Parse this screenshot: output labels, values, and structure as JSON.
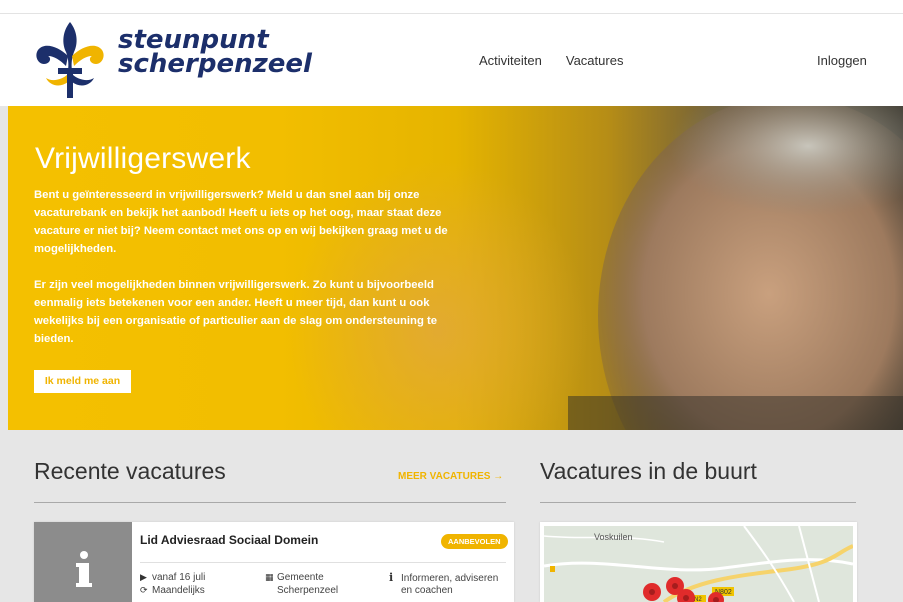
{
  "header": {
    "logo_line1": "steunpunt",
    "logo_line2": "scherpenzeel",
    "nav": [
      "Activiteiten",
      "Vacatures"
    ],
    "login": "Inloggen"
  },
  "hero": {
    "title": "Vrijwilligerswerk",
    "p1": "Bent u geïnteresseerd in vrijwilligerswerk? Meld u dan snel aan bij onze vacaturebank en bekijk het aanbod! Heeft u iets op het oog, maar staat deze vacature er niet bij? Neem contact met ons op en wij bekijken graag met u de mogelijkheden.",
    "p2": "Er zijn veel mogelijkheden binnen vrijwilligerswerk. Zo kunt u bijvoorbeeld eenmalig iets betekenen voor een ander. Heeft u meer tijd, dan kunt u ook wekelijks bij een organisatie of particulier aan de slag om ondersteuning te bieden.",
    "button": "Ik meld me aan"
  },
  "recent": {
    "heading": "Recente vacatures",
    "more": "MEER VACATURES →",
    "card": {
      "title": "Lid Adviesraad Sociaal Domein",
      "badge": "AANBEVOLEN",
      "date": "vanaf 16 juli",
      "frequency": "Maandelijks",
      "org_line1": "Gemeente",
      "org_line2": "Scherpenzeel",
      "type_line1": "Informeren, adviseren",
      "type_line2": "en coachen"
    }
  },
  "nearby": {
    "heading": "Vacatures in de buurt",
    "map_labels": [
      "Voskuilen",
      "N802",
      "N2"
    ]
  },
  "colors": {
    "accent": "#f0b400",
    "logo_blue": "#1c2f6b"
  },
  "icons": [
    "fleur-de-lis-logo",
    "info-icon",
    "play-icon",
    "refresh-icon",
    "building-icon",
    "info-small-icon",
    "map-marker-icon"
  ]
}
